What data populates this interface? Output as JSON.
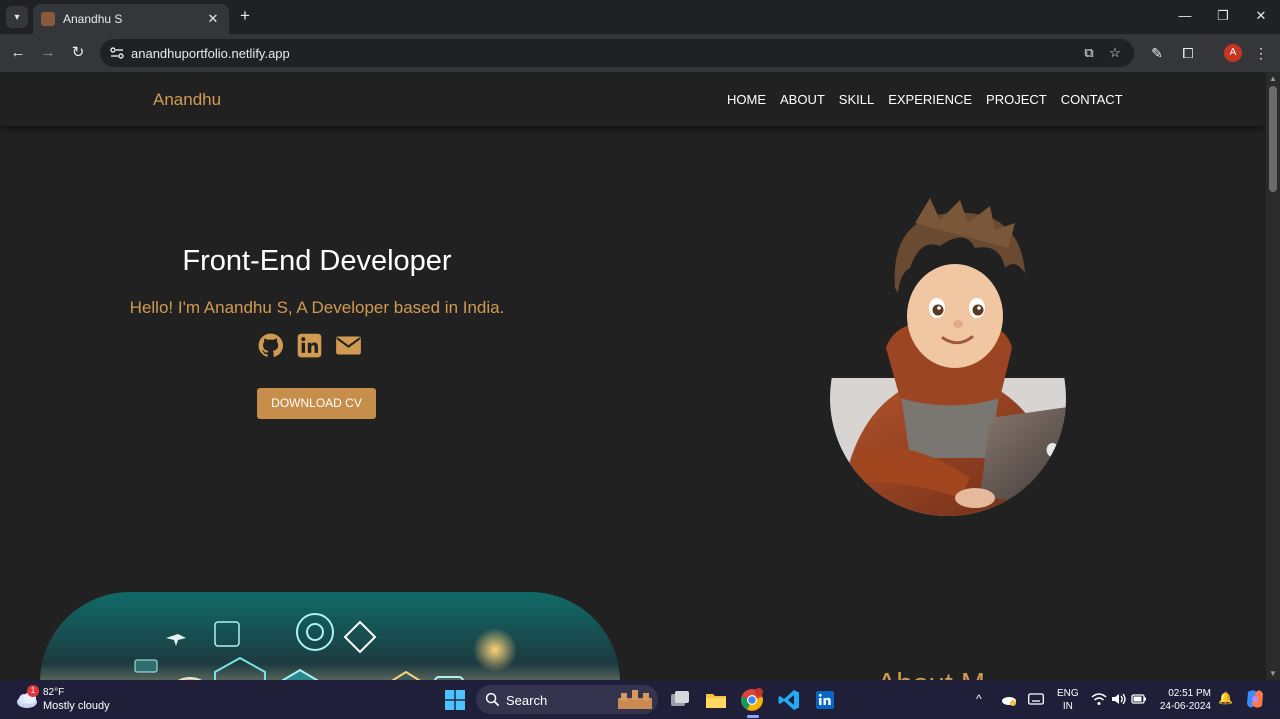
{
  "browser": {
    "tab_title": "Anandhu S",
    "url": "anandhuportfolio.netlify.app",
    "profile_initial": "A"
  },
  "site": {
    "brand": "Anandhu",
    "menu": [
      "HOME",
      "ABOUT",
      "SKILL",
      "EXPERIENCE",
      "PROJECT",
      "CONTACT"
    ],
    "hero_title": "Front-End Developer",
    "hero_subtitle": "Hello! I'm Anandhu S, A Developer based in India.",
    "social_icons": [
      "github-icon",
      "linkedin-icon",
      "envelope-icon"
    ],
    "cv_button": "DOWNLOAD CV",
    "about_heading": "About M",
    "colors": {
      "accent": "#d19a52",
      "button": "#c78d4a",
      "background": "#212121"
    }
  },
  "taskbar": {
    "weather_badge": "1",
    "weather_temp": "82°F",
    "weather_desc": "Mostly cloudy",
    "search_label": "Search",
    "lang_line1": "ENG",
    "lang_line2": "IN",
    "time": "02:51 PM",
    "date": "24-06-2024"
  }
}
